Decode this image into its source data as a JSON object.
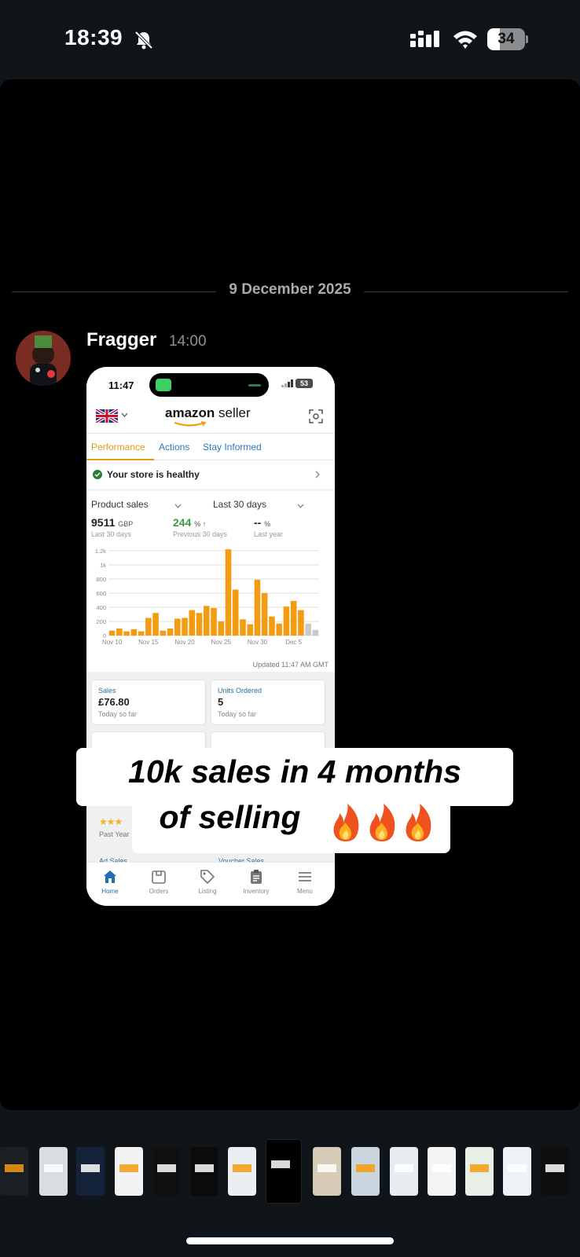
{
  "status_bar": {
    "time": "18:39",
    "battery": "34",
    "battery_level": 0.34
  },
  "message": {
    "date": "9 December 2025",
    "author": "Fragger",
    "time": "14:00"
  },
  "screenshot": {
    "status_time": "11:47",
    "battery": "53",
    "logo_word1": "amazon",
    "logo_word2": " seller",
    "tabs": [
      "Performance",
      "Actions",
      "Stay Informed"
    ],
    "health": "Your store is healthy",
    "dropdown_metric": "Product sales",
    "dropdown_range": "Last 30 days",
    "metrics": [
      {
        "value": "9511",
        "unit": "GBP",
        "sub": "Last 30 days"
      },
      {
        "value": "244",
        "unit": "% ↑",
        "sub": "Previous 30 days"
      },
      {
        "value": "--",
        "unit": "%",
        "sub": "Last year"
      }
    ],
    "updated": "Updated 11:47 AM GMT",
    "tiles": [
      {
        "label": "Sales",
        "value": "£76.80",
        "sub": "Today so far"
      },
      {
        "label": "Units Ordered",
        "value": "5",
        "sub": "Today so far"
      }
    ],
    "stars": "★★★",
    "past_year": "Past Year",
    "ad_sales": "Ad Sales",
    "voucher_sales": "Voucher Sales",
    "nav": [
      "Home",
      "Orders",
      "Listing",
      "Inventory",
      "Menu"
    ]
  },
  "caption": {
    "line1": "10k sales in 4 months",
    "line2": "of selling"
  },
  "chart_data": {
    "type": "bar",
    "x_ticks": [
      "Nov 10",
      "Nov 15",
      "Nov 20",
      "Nov 25",
      "Nov 30",
      "Dec 5"
    ],
    "y_ticks": [
      "0",
      "200",
      "400",
      "600",
      "800",
      "1k",
      "1.2k"
    ],
    "ylim": [
      0,
      1200
    ],
    "values": [
      70,
      100,
      60,
      90,
      60,
      250,
      320,
      70,
      100,
      240,
      250,
      360,
      320,
      420,
      390,
      200,
      1220,
      650,
      230,
      160,
      790,
      600,
      270,
      170,
      410,
      490,
      360,
      170,
      80
    ],
    "colors": {
      "bar": "#f39c12",
      "partial": "#c9c9c9"
    },
    "partial_from_index": 27
  },
  "colors": {
    "accent_amazon": "#e19b14",
    "link_blue": "#2b78b7"
  }
}
